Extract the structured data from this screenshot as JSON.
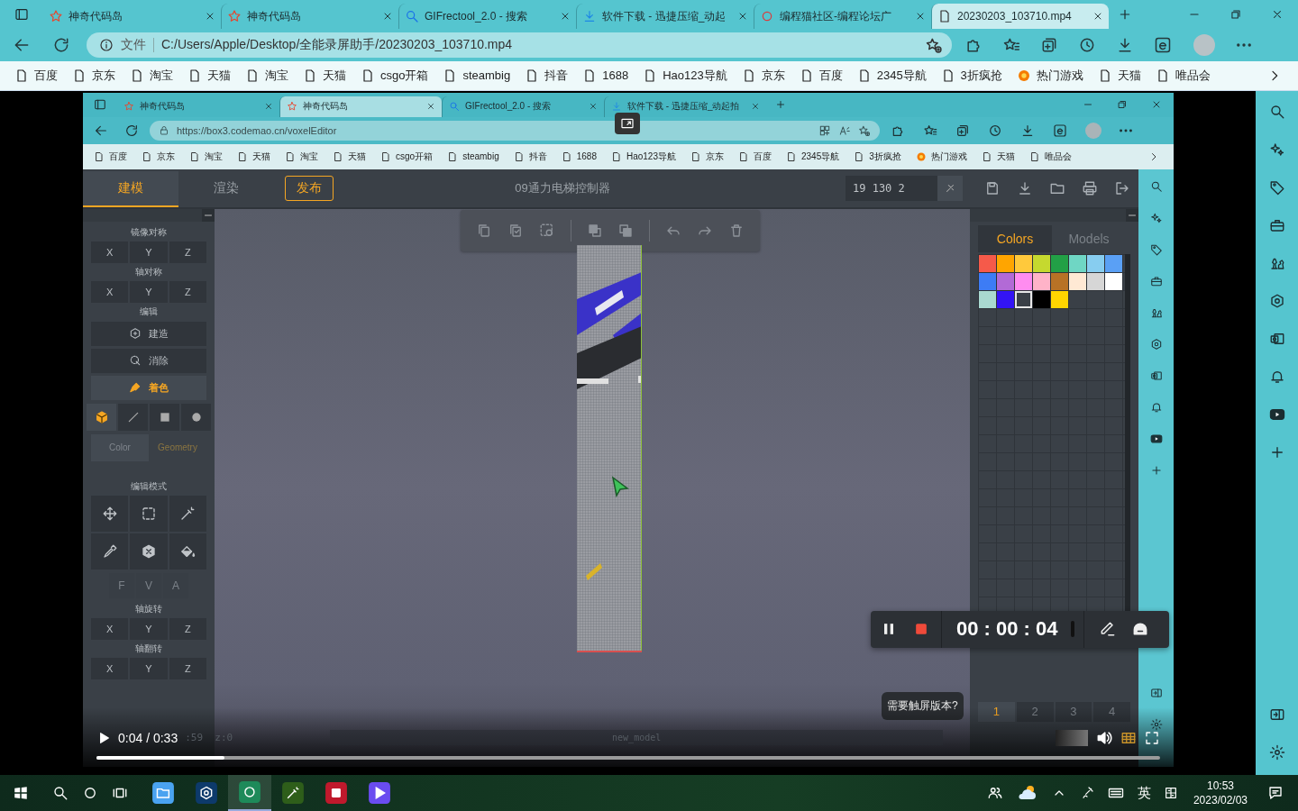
{
  "browser": {
    "tabs": [
      {
        "title": "神奇代码岛",
        "kind": "star",
        "selected": false
      },
      {
        "title": "神奇代码岛",
        "kind": "star",
        "selected": false
      },
      {
        "title": "GIFrectool_2.0 - 搜索",
        "kind": "search",
        "selected": false
      },
      {
        "title": "软件下载 - 迅捷压缩_动起",
        "kind": "download",
        "selected": false
      },
      {
        "title": "编程猫社区-编程论坛广",
        "kind": "round",
        "selected": false
      },
      {
        "title": "20230203_103710.mp4",
        "kind": "file",
        "selected": true
      }
    ],
    "address": {
      "label": "文件",
      "url": "C:/Users/Apple/Desktop/全能录屏助手/20230203_103710.mp4"
    },
    "bookmarks": [
      {
        "label": "百度",
        "kind": "page"
      },
      {
        "label": "京东",
        "kind": "page"
      },
      {
        "label": "淘宝",
        "kind": "page"
      },
      {
        "label": "天猫",
        "kind": "page"
      },
      {
        "label": "淘宝",
        "kind": "page"
      },
      {
        "label": "天猫",
        "kind": "page"
      },
      {
        "label": "csgo开箱",
        "kind": "page"
      },
      {
        "label": "steambig",
        "kind": "page"
      },
      {
        "label": "抖音",
        "kind": "page"
      },
      {
        "label": "1688",
        "kind": "page"
      },
      {
        "label": "Hao123导航",
        "kind": "page"
      },
      {
        "label": "京东",
        "kind": "page"
      },
      {
        "label": "百度",
        "kind": "page"
      },
      {
        "label": "2345导航",
        "kind": "page"
      },
      {
        "label": "3折疯抢",
        "kind": "page"
      },
      {
        "label": "热门游戏",
        "kind": "game"
      },
      {
        "label": "天猫",
        "kind": "page"
      },
      {
        "label": "唯品会",
        "kind": "page"
      }
    ]
  },
  "video": {
    "browser": {
      "tabs": [
        {
          "title": "神奇代码岛",
          "kind": "star",
          "selected": false
        },
        {
          "title": "神奇代码岛",
          "kind": "star",
          "selected": true
        },
        {
          "title": "GIFrectool_2.0 - 搜索",
          "kind": "search",
          "selected": false
        },
        {
          "title": "软件下载 - 迅捷压缩_动起拍",
          "kind": "download",
          "selected": false
        }
      ],
      "url": "https://box3.codemao.cn/voxelEditor",
      "bookmarks": [
        {
          "label": "百度",
          "kind": "page"
        },
        {
          "label": "京东",
          "kind": "page"
        },
        {
          "label": "淘宝",
          "kind": "page"
        },
        {
          "label": "天猫",
          "kind": "page"
        },
        {
          "label": "淘宝",
          "kind": "page"
        },
        {
          "label": "天猫",
          "kind": "page"
        },
        {
          "label": "csgo开箱",
          "kind": "page"
        },
        {
          "label": "steambig",
          "kind": "page"
        },
        {
          "label": "抖音",
          "kind": "page"
        },
        {
          "label": "1688",
          "kind": "page"
        },
        {
          "label": "Hao123导航",
          "kind": "page"
        },
        {
          "label": "京东",
          "kind": "page"
        },
        {
          "label": "百度",
          "kind": "page"
        },
        {
          "label": "2345导航",
          "kind": "page"
        },
        {
          "label": "3折疯抢",
          "kind": "page"
        },
        {
          "label": "热门游戏",
          "kind": "game"
        },
        {
          "label": "天猫",
          "kind": "page"
        },
        {
          "label": "唯品会",
          "kind": "page"
        }
      ]
    },
    "editor": {
      "modes": [
        {
          "label": "建模",
          "selected": true
        },
        {
          "label": "渲染",
          "selected": false
        }
      ],
      "publish": "发布",
      "title": "09通力电梯控制器",
      "coords": "19 130 2",
      "mirror": {
        "title": "镜像对称",
        "axes": [
          "X",
          "Y",
          "Z"
        ]
      },
      "symmetry": {
        "title": "轴对称",
        "axes": [
          "X",
          "Y",
          "Z"
        ]
      },
      "edit": {
        "title": "编辑",
        "actions": [
          {
            "label": "建造",
            "kind": "build",
            "selected": false
          },
          {
            "label": "消除",
            "kind": "erase",
            "selected": false
          },
          {
            "label": "着色",
            "kind": "paint",
            "selected": true
          }
        ]
      },
      "brushes": [
        {
          "kind": "cube",
          "selected": true
        },
        {
          "kind": "line",
          "selected": false
        },
        {
          "kind": "square",
          "selected": false
        },
        {
          "kind": "circle",
          "selected": false
        }
      ],
      "brush_tabs": [
        {
          "label": "Color",
          "selected": false
        },
        {
          "label": "Geometry",
          "selected": true
        }
      ],
      "edit_mode": {
        "title": "编辑模式"
      },
      "fva": [
        {
          "label": "F",
          "disabled": true
        },
        {
          "label": "V",
          "disabled": true
        },
        {
          "label": "A",
          "disabled": true
        }
      ],
      "rotate": {
        "title": "轴旋转",
        "axes": [
          "X",
          "Y",
          "Z"
        ]
      },
      "flip": {
        "title": "轴翻转",
        "axes": [
          "X",
          "Y",
          "Z"
        ]
      },
      "panel_tabs": [
        {
          "label": "Colors",
          "selected": true
        },
        {
          "label": "Models",
          "selected": false
        }
      ],
      "swatches": [
        {
          "color": "#f55a4a",
          "selected": false
        },
        {
          "color": "#ffa500",
          "selected": false
        },
        {
          "color": "#ffc93c",
          "selected": false
        },
        {
          "color": "#c5d92f",
          "selected": false
        },
        {
          "color": "#22a046",
          "selected": false
        },
        {
          "color": "#6fd6c4",
          "selected": false
        },
        {
          "color": "#87cdf0",
          "selected": false
        },
        {
          "color": "#5aa0f5",
          "selected": false
        },
        {
          "color": "#3d7cf5",
          "selected": false
        },
        {
          "color": "#b26ad6",
          "selected": false
        },
        {
          "color": "#ff8cf0",
          "selected": false
        },
        {
          "color": "#ffb3c8",
          "selected": false
        },
        {
          "color": "#b87226",
          "selected": false
        },
        {
          "color": "#ffe9d4",
          "selected": false
        },
        {
          "color": "#d6d6d6",
          "selected": false
        },
        {
          "color": "#ffffff",
          "selected": false
        },
        {
          "color": "#a9d9d0",
          "selected": false
        },
        {
          "color": "#3314f5",
          "selected": false
        },
        {
          "color": "#3a4047",
          "selected": true
        },
        {
          "color": "#000000",
          "selected": false
        },
        {
          "color": "#ffd500",
          "selected": false
        }
      ],
      "pages": [
        {
          "label": "1",
          "selected": true
        },
        {
          "label": "2",
          "selected": false
        },
        {
          "label": "3",
          "selected": false
        },
        {
          "label": "4",
          "selected": false
        }
      ],
      "hint": "需要触屏版本?",
      "status": ":59  z:0",
      "model_name": "new_model"
    },
    "recorder": {
      "time": "00 : 00 : 04"
    },
    "player": {
      "time": "0:04 / 0:33",
      "level": 0.12
    }
  },
  "taskbar": {
    "ime": "英",
    "time": "10:53",
    "date": "2023/02/03"
  }
}
